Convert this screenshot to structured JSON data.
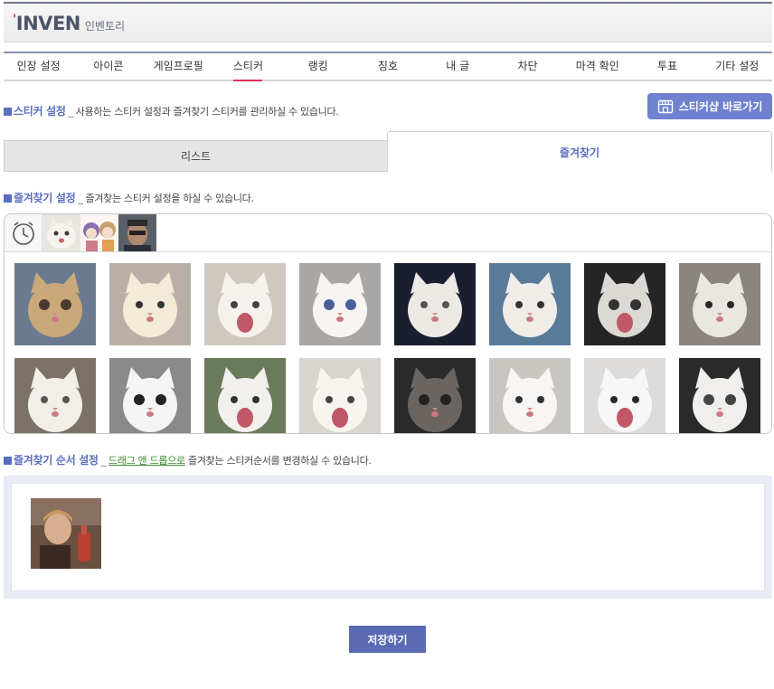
{
  "header": {
    "logo_main": "INVEN",
    "logo_sub": "인벤토리"
  },
  "nav": [
    {
      "label": "인장 설정"
    },
    {
      "label": "아이콘"
    },
    {
      "label": "게임프로필"
    },
    {
      "label": "스티커",
      "active": true
    },
    {
      "label": "랭킹"
    },
    {
      "label": "칭호"
    },
    {
      "label": "내 글"
    },
    {
      "label": "차단"
    },
    {
      "label": "마격 확인"
    },
    {
      "label": "투표"
    },
    {
      "label": "기타 설정"
    }
  ],
  "sticker_section": {
    "title": "스티커 설정",
    "dash": "_",
    "desc": "사용하는 스티커 설정과 즐겨찾기 스티커를 관리하실 수 있습니다."
  },
  "shop_button": {
    "label": "스티커샵 바로가기",
    "icon": "store-icon"
  },
  "tabs": {
    "list": "리스트",
    "favorites": "즐겨찾기",
    "active": "favorites"
  },
  "fav_section": {
    "title": "즐겨찾기 설정",
    "dash": "_",
    "desc": "즐겨찾는 스티커 설정을 하실 수 있습니다."
  },
  "packs": [
    {
      "name": "recent-clock-icon"
    },
    {
      "name": "cat-pack"
    },
    {
      "name": "girls-pack"
    },
    {
      "name": "man-pack"
    }
  ],
  "order_section": {
    "title": "즐겨찾기 순서 설정",
    "dash": "_",
    "link": "드래그 앤 드롭으로",
    "desc": "즐겨찾는 스티커순서를 변경하실 수 있습니다."
  },
  "save_button": {
    "label": "저장하기"
  },
  "colors": {
    "accent": "#5a6ec0",
    "shop_button": "#6e82cf",
    "save_button": "#5a6ab5",
    "active_underline": "#e0315c",
    "link": "#3d8b2d"
  }
}
